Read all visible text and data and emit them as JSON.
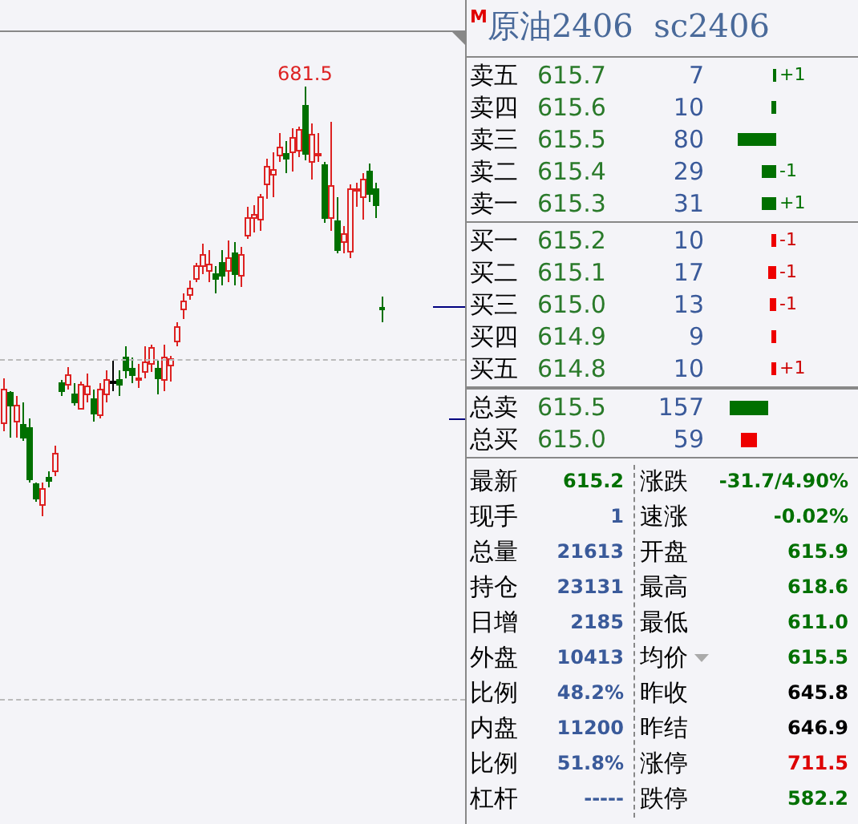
{
  "chart": {
    "peak_label": "681.5"
  },
  "quote": {
    "badge": "M",
    "title": "原油2406  sc2406"
  },
  "sell_levels": [
    {
      "label": "卖五",
      "price": "615.7",
      "qty": "7",
      "change": "+1"
    },
    {
      "label": "卖四",
      "price": "615.6",
      "qty": "10"
    },
    {
      "label": "卖三",
      "price": "615.5",
      "qty": "80"
    },
    {
      "label": "卖二",
      "price": "615.4",
      "qty": "29",
      "change": "-1"
    },
    {
      "label": "卖一",
      "price": "615.3",
      "qty": "31",
      "change": "+1"
    }
  ],
  "buy_levels": [
    {
      "label": "买一",
      "price": "615.2",
      "qty": "10",
      "change": "-1"
    },
    {
      "label": "买二",
      "price": "615.1",
      "qty": "17",
      "change": "-1"
    },
    {
      "label": "买三",
      "price": "615.0",
      "qty": "13",
      "change": "-1"
    },
    {
      "label": "买四",
      "price": "614.9",
      "qty": "9"
    },
    {
      "label": "买五",
      "price": "614.8",
      "qty": "10",
      "change": "+1"
    }
  ],
  "totals": [
    {
      "label": "总卖",
      "price": "615.5",
      "qty": "157",
      "color": "#007000"
    },
    {
      "label": "总买",
      "price": "615.0",
      "qty": "59",
      "color": "#ee0000"
    }
  ],
  "stats_left": [
    {
      "label": "最新",
      "value": "615.2",
      "kind": "fall"
    },
    {
      "label": "现手",
      "value": "1",
      "kind": "volume"
    },
    {
      "label": "总量",
      "value": "21613",
      "kind": "volume"
    },
    {
      "label": "持仓",
      "value": "23131",
      "kind": "volume"
    },
    {
      "label": "日增",
      "value": "2185",
      "kind": "volume"
    },
    {
      "label": "外盘",
      "value": "10413",
      "kind": "volume"
    },
    {
      "label": "比例",
      "value": "48.2%",
      "kind": "volume"
    },
    {
      "label": "内盘",
      "value": "11200",
      "kind": "volume"
    },
    {
      "label": "比例",
      "value": "51.8%",
      "kind": "volume"
    },
    {
      "label": "杠杆",
      "value": "-----",
      "kind": "volume"
    }
  ],
  "stats_right": [
    {
      "label": "涨跌",
      "value": "-31.7/4.90%",
      "kind": "fall"
    },
    {
      "label": "速涨",
      "value": "-0.02%",
      "kind": "fall"
    },
    {
      "label": "开盘",
      "value": "615.9",
      "kind": "fall"
    },
    {
      "label": "最高",
      "value": "618.6",
      "kind": "fall"
    },
    {
      "label": "最低",
      "value": "611.0",
      "kind": "fall"
    },
    {
      "label": "均价",
      "value": "615.5",
      "kind": "fall",
      "dropdown": true
    },
    {
      "label": "昨收",
      "value": "645.8",
      "kind": "base"
    },
    {
      "label": "昨结",
      "value": "646.9",
      "kind": "base"
    },
    {
      "label": "涨停",
      "value": "711.5",
      "kind": "rise"
    },
    {
      "label": "跌停",
      "value": "582.2",
      "kind": "fall"
    }
  ]
}
